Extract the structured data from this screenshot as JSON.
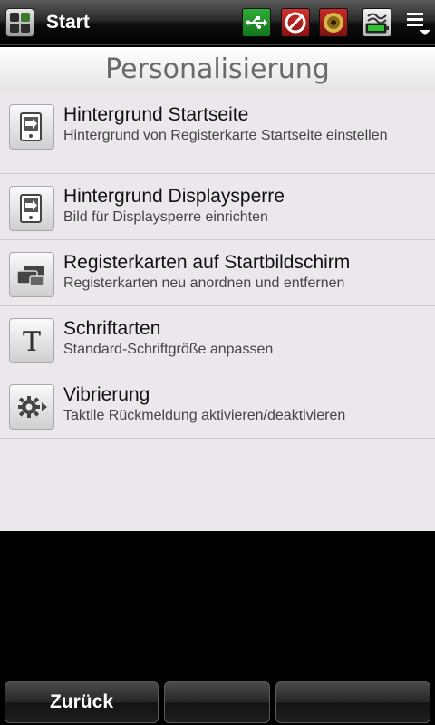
{
  "statusbar": {
    "title": "Start",
    "icons": [
      "start-menu-icon",
      "usb-connected-icon",
      "no-signal-icon",
      "speaker-icon",
      "battery-charging-icon",
      "overflow-menu-icon"
    ],
    "colors": {
      "usb": "#2fae3a",
      "block": "#d23131",
      "speaker": "#c92a2a"
    }
  },
  "page": {
    "title": "Personalisierung"
  },
  "items": [
    {
      "title": "Hintergrund Startseite",
      "subtitle": "Hintergrund von Registerkarte Startseite einstellen",
      "icon": "home-wallpaper-icon"
    },
    {
      "title": "Hintergrund Displaysperre",
      "subtitle": "Bild für Displaysperre einrichten",
      "icon": "lockscreen-wallpaper-icon"
    },
    {
      "title": "Registerkarten auf Startbildschirm",
      "subtitle": "Registerkarten neu anordnen und entfernen",
      "icon": "tabs-icon"
    },
    {
      "title": "Schriftarten",
      "subtitle": "Standard-Schriftgröße anpassen",
      "icon": "font-icon"
    },
    {
      "title": "Vibrierung",
      "subtitle": "Taktile Rückmeldung aktivieren/deaktivieren",
      "icon": "vibration-gear-icon"
    }
  ],
  "softkeys": {
    "left": "Zurück",
    "middle": "",
    "right": ""
  }
}
